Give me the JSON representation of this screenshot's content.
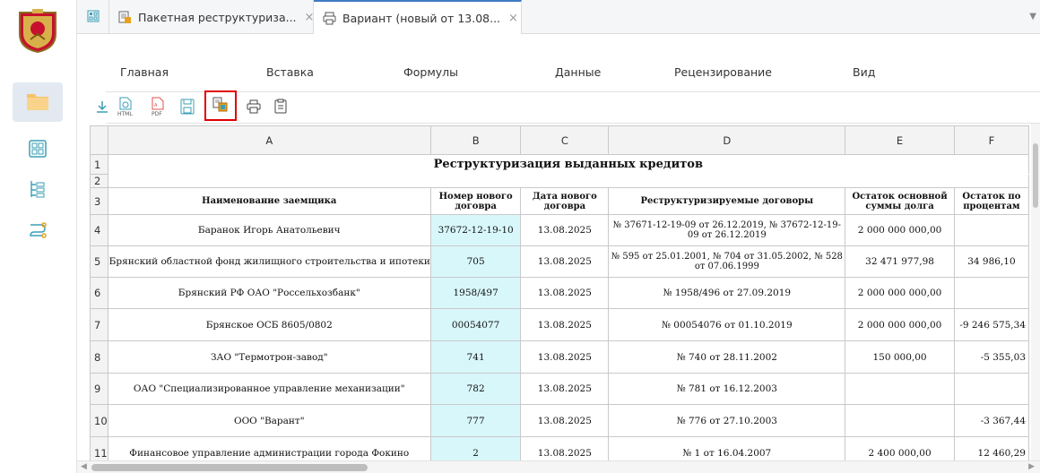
{
  "tabs": [
    {
      "label": "Пакетная реструктуриза...",
      "close": "×"
    },
    {
      "label": "Вариант (новый от 13.08...",
      "close": "×"
    }
  ],
  "ribbon": {
    "tabs": [
      "Главная",
      "Вставка",
      "Формулы",
      "Данные",
      "Рецензирование",
      "Вид"
    ],
    "buttons": [
      "download-icon",
      "export-html-icon",
      "export-pdf-icon",
      "save-copy-icon",
      "copy-to-package-icon",
      "print-icon",
      "clipboard-icon"
    ]
  },
  "sheet": {
    "columns": [
      "A",
      "B",
      "C",
      "D",
      "E",
      "F"
    ],
    "row_numbers": [
      "1",
      "2",
      "3",
      "4",
      "5",
      "6",
      "7",
      "8",
      "9",
      "10",
      "11"
    ],
    "title": "Реструктуризация выданных кредитов",
    "headers": [
      "Наименование заемщика",
      "Номер нового договра",
      "Дата нового договра",
      "Реструктуризируемые договоры",
      "Остаток основной суммы долга",
      "Остаток по процентам"
    ],
    "rows": [
      [
        "Баранок Игорь Анатольевич",
        "37672-12-19-10",
        "13.08.2025",
        "№ 37671-12-19-09 от 26.12.2019, № 37672-12-19-09 от 26.12.2019",
        "2 000 000 000,00",
        ""
      ],
      [
        "Брянский областной фонд жилищного строительства и ипотеки",
        "705",
        "13.08.2025",
        "№ 595 от 25.01.2001, № 704 от 31.05.2002, № 528 от 07.06.1999",
        "32 471 977,98",
        "34 986,10"
      ],
      [
        "Брянский РФ ОАО \"Россельхозбанк\"",
        "1958/497",
        "13.08.2025",
        "№ 1958/496 от 27.09.2019",
        "2 000 000 000,00",
        ""
      ],
      [
        "Брянское ОСБ 8605/0802",
        "00054077",
        "13.08.2025",
        "№ 00054076 от 01.10.2019",
        "2 000 000 000,00",
        "-9 246 575,34"
      ],
      [
        "ЗАО \"Термотрон-завод\"",
        "741",
        "13.08.2025",
        "№ 740 от 28.11.2002",
        "150 000,00",
        "-5 355,03"
      ],
      [
        "ОАО \"Специализированное управление механизации\"",
        "782",
        "13.08.2025",
        "№ 781 от 16.12.2003",
        "",
        ""
      ],
      [
        "ООО \"Варант\"",
        "777",
        "13.08.2025",
        "№ 776 от 27.10.2003",
        "",
        "-3 367,44"
      ],
      [
        "Финансовое управление администрации города Фокино",
        "2",
        "13.08.2025",
        "№ 1 от 16.04.2007",
        "2 400 000,00",
        "12 460,29"
      ]
    ]
  },
  "colors": {
    "accent": "#3f7bc4",
    "highlight_border": "#e00000",
    "cyan_cell": "#d8f7fb"
  }
}
